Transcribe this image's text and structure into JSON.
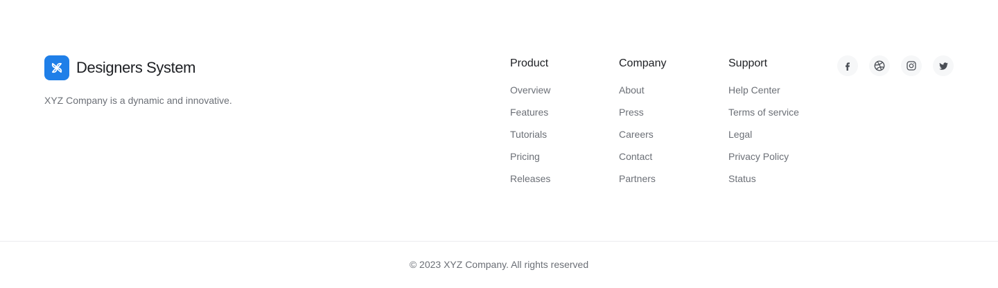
{
  "brand": {
    "name": "Designers System",
    "tagline": "XYZ Company is a dynamic and innovative.",
    "logo_color": "#1f7fe8"
  },
  "columns": [
    {
      "title": "Product",
      "links": [
        "Overview",
        "Features",
        "Tutorials",
        "Pricing",
        "Releases"
      ]
    },
    {
      "title": "Company",
      "links": [
        "About",
        "Press",
        "Careers",
        "Contact",
        "Partners"
      ]
    },
    {
      "title": "Support",
      "links": [
        "Help Center",
        "Terms of service",
        "Legal",
        "Privacy Policy",
        "Status"
      ]
    }
  ],
  "socials": [
    "facebook-icon",
    "dribbble-icon",
    "instagram-icon",
    "twitter-icon"
  ],
  "copyright": "© 2023 XYZ Company. All rights reserved"
}
